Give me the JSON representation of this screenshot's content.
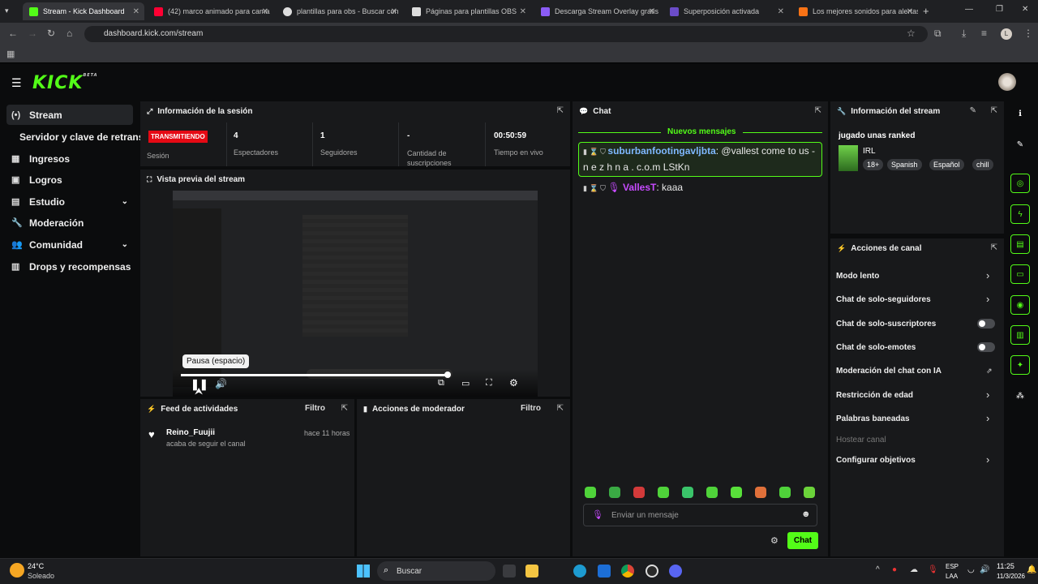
{
  "browser": {
    "tabs": [
      {
        "label": "Stream - Kick Dashboard",
        "fav": "#53fc18"
      },
      {
        "label": "(42) marco animado para cama",
        "fav": "#ff0033"
      },
      {
        "label": "plantillas para obs - Buscar con",
        "fav": "#dddddd"
      },
      {
        "label": "Páginas para plantillas OBS",
        "fav": "#dddddd"
      },
      {
        "label": "Descarga Stream Overlay gratis",
        "fav": "#8b5cf6"
      },
      {
        "label": "Superposición activada",
        "fav": "#6b4cc8"
      },
      {
        "label": "Los mejores sonidos para alertas",
        "fav": "#f97316"
      }
    ],
    "url": "dashboard.kick.com/stream",
    "profile_initial": "L"
  },
  "app": {
    "logo": "KICK",
    "beta": "BETA"
  },
  "sidebar": {
    "items": [
      {
        "label": "Stream",
        "icon": "(•)"
      },
      {
        "label": "Servidor y clave de retransmisión",
        "icon": ""
      },
      {
        "label": "Ingresos",
        "icon": "▦"
      },
      {
        "label": "Logros",
        "icon": "▣"
      },
      {
        "label": "Estudio",
        "icon": "▤"
      },
      {
        "label": "Moderación",
        "icon": "🔧"
      },
      {
        "label": "Comunidad",
        "icon": "👥"
      },
      {
        "label": "Drops y recompensas",
        "icon": "▥"
      }
    ]
  },
  "session": {
    "title": "Información de la sesión",
    "badge": "TRANSMITIENDO",
    "badge_label": "Sesión",
    "stats": [
      {
        "value": "4",
        "label": "Espectadores"
      },
      {
        "value": "1",
        "label": "Seguidores"
      },
      {
        "value": "-",
        "label": "Cantidad de suscripciones"
      },
      {
        "value": "00:50:59",
        "label": "Tiempo en vivo"
      }
    ]
  },
  "preview": {
    "title": "Vista previa del stream",
    "tooltip": "Pausa (espacio)"
  },
  "feed": {
    "title": "Feed de actividades",
    "filter": "Filtro",
    "items": [
      {
        "user": "Reino_Fuujii",
        "action": "acaba de seguir el canal",
        "time": "hace 11 horas"
      }
    ]
  },
  "mod": {
    "title": "Acciones de moderador",
    "filter": "Filtro"
  },
  "chat": {
    "title": "Chat",
    "new_messages": "Nuevos mensajes",
    "messages": [
      {
        "user": "suburbanfootingavljbta",
        "text": ": @vallest come to us - n e z h n a . c.o.m LStKn",
        "color": "#7fb8ff"
      },
      {
        "user": "VallesT",
        "text": ": kaaa",
        "color": "#c74bff"
      }
    ],
    "placeholder": "Enviar un mensaje",
    "send": "Chat"
  },
  "stream_info": {
    "title": "Información del stream",
    "stream_title": "jugado unas ranked",
    "category": "IRL",
    "tags": [
      "18+",
      "Spanish",
      "Español",
      "chill"
    ]
  },
  "channel_actions": {
    "title": "Acciones de canal",
    "items": [
      {
        "label": "Modo lento",
        "control": "arrow"
      },
      {
        "label": "Chat de solo-seguidores",
        "control": "arrow"
      },
      {
        "label": "Chat de solo-suscriptores",
        "control": "toggle"
      },
      {
        "label": "Chat de solo-emotes",
        "control": "toggle"
      },
      {
        "label": "Moderación del chat con IA",
        "control": "external"
      },
      {
        "label": "Restricción de edad",
        "control": "arrow"
      },
      {
        "label": "Palabras baneadas",
        "control": "arrow"
      },
      {
        "label": "Hostear canal",
        "control": "none"
      },
      {
        "label": "Configurar objetivos",
        "control": "arrow"
      }
    ]
  },
  "taskbar": {
    "weather_temp": "24°C",
    "weather_text": "Soleado",
    "search": "Buscar",
    "lang1": "ESP",
    "lang2": "LAA",
    "time": "11:25",
    "date": "11/3/2026"
  }
}
